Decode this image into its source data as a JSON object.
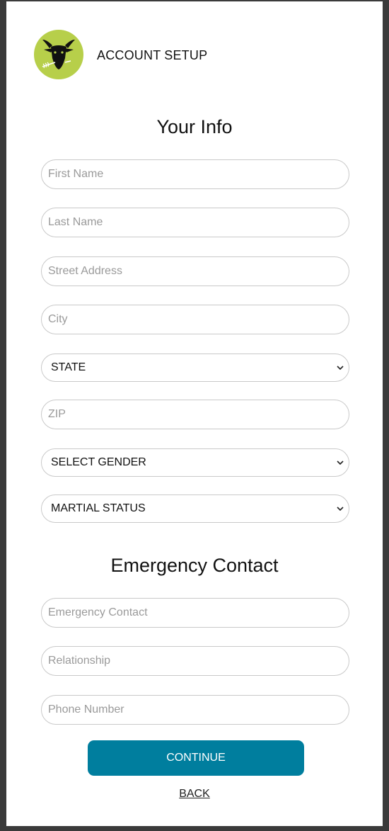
{
  "header": {
    "title": "ACCOUNT SETUP",
    "logo_icon": "goat-head-icon",
    "logo_bg": "#b7cf4a"
  },
  "your_info": {
    "heading": "Your Info",
    "first_name": {
      "placeholder": "First Name",
      "value": ""
    },
    "last_name": {
      "placeholder": "Last Name",
      "value": ""
    },
    "street_address": {
      "placeholder": "Street Address",
      "value": ""
    },
    "city": {
      "placeholder": "City",
      "value": ""
    },
    "state": {
      "selected": "STATE"
    },
    "zip": {
      "placeholder": "ZIP",
      "value": ""
    },
    "gender": {
      "selected": "SELECT GENDER"
    },
    "marital_status": {
      "selected": "MARTIAL STATUS"
    }
  },
  "emergency": {
    "heading": "Emergency Contact",
    "contact": {
      "placeholder": "Emergency Contact",
      "value": ""
    },
    "relationship": {
      "placeholder": "Relationship",
      "value": ""
    },
    "phone": {
      "placeholder": "Phone Number",
      "value": ""
    }
  },
  "actions": {
    "continue_label": "CONTINUE",
    "back_label": "BACK"
  },
  "colors": {
    "accent": "#007e9e",
    "border": "#c9c9c9"
  }
}
